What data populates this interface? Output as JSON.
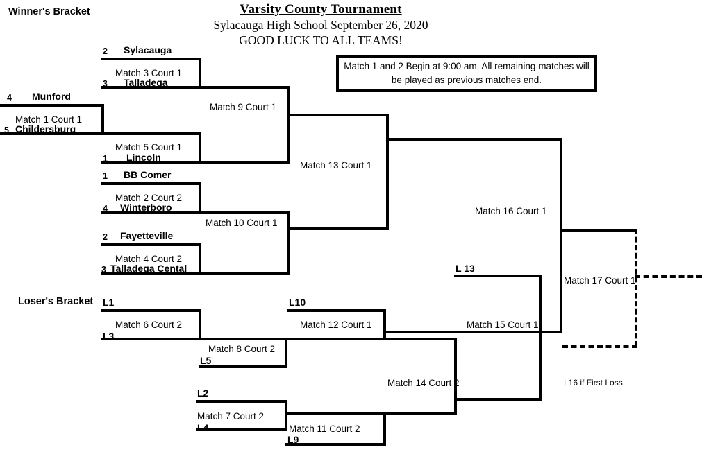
{
  "title": {
    "main": "Varsity County Tournament",
    "subtitle": "Sylacauga High School September 26, 2020",
    "goodluck": "GOOD LUCK TO ALL TEAMS!"
  },
  "info_note": "Match 1 and 2 Begin at 9:00 am.  All remaining matches will be played as previous matches end.",
  "headings": {
    "winners": "Winner's Bracket",
    "losers": "Loser's Bracket"
  },
  "winners_bracket": {
    "teams": [
      {
        "seed": "2",
        "name": "Sylacauga"
      },
      {
        "seed": "3",
        "name": "Talladega"
      },
      {
        "seed": "4",
        "name": "Munford"
      },
      {
        "seed": "5",
        "name": "Childersburg"
      },
      {
        "seed": "1",
        "name": "Lincoln"
      },
      {
        "seed": "1",
        "name": "BB Comer"
      },
      {
        "seed": "4",
        "name": "Winterboro"
      },
      {
        "seed": "2",
        "name": "Fayetteville"
      },
      {
        "seed": "3",
        "name": "Talladega Cental"
      }
    ],
    "matches": [
      {
        "id": "m1",
        "label": "Match 1 Court 1"
      },
      {
        "id": "m2",
        "label": "Match 2 Court 2"
      },
      {
        "id": "m3",
        "label": "Match 3 Court 1"
      },
      {
        "id": "m4",
        "label": "Match 4 Court 2"
      },
      {
        "id": "m5",
        "label": "Match 5 Court 1"
      },
      {
        "id": "m9",
        "label": "Match 9 Court 1"
      },
      {
        "id": "m10",
        "label": "Match 10 Court 1"
      },
      {
        "id": "m13",
        "label": "Match 13 Court 1"
      },
      {
        "id": "m16",
        "label": "Match 16 Court 1"
      }
    ]
  },
  "losers_bracket": {
    "slots": [
      {
        "id": "l1",
        "label": "L1"
      },
      {
        "id": "l3",
        "label": "L3"
      },
      {
        "id": "l5",
        "label": "L5"
      },
      {
        "id": "l10",
        "label": "L10"
      },
      {
        "id": "l2",
        "label": "L2"
      },
      {
        "id": "l4",
        "label": "L4"
      },
      {
        "id": "l9",
        "label": "L9"
      },
      {
        "id": "l13",
        "label": "L 13"
      }
    ],
    "matches": [
      {
        "id": "m6",
        "label": "Match 6 Court 2"
      },
      {
        "id": "m7",
        "label": "Match 7 Court 2"
      },
      {
        "id": "m8",
        "label": "Match 8 Court 2"
      },
      {
        "id": "m11",
        "label": "Match 11 Court 2"
      },
      {
        "id": "m12",
        "label": "Match 12 Court 1"
      },
      {
        "id": "m14",
        "label": "Match 14 Court 2"
      },
      {
        "id": "m15",
        "label": "Match 15 Court 1"
      }
    ]
  },
  "final": {
    "match17": "Match 17 Court 1",
    "if_first_loss": "L16 if First Loss"
  }
}
